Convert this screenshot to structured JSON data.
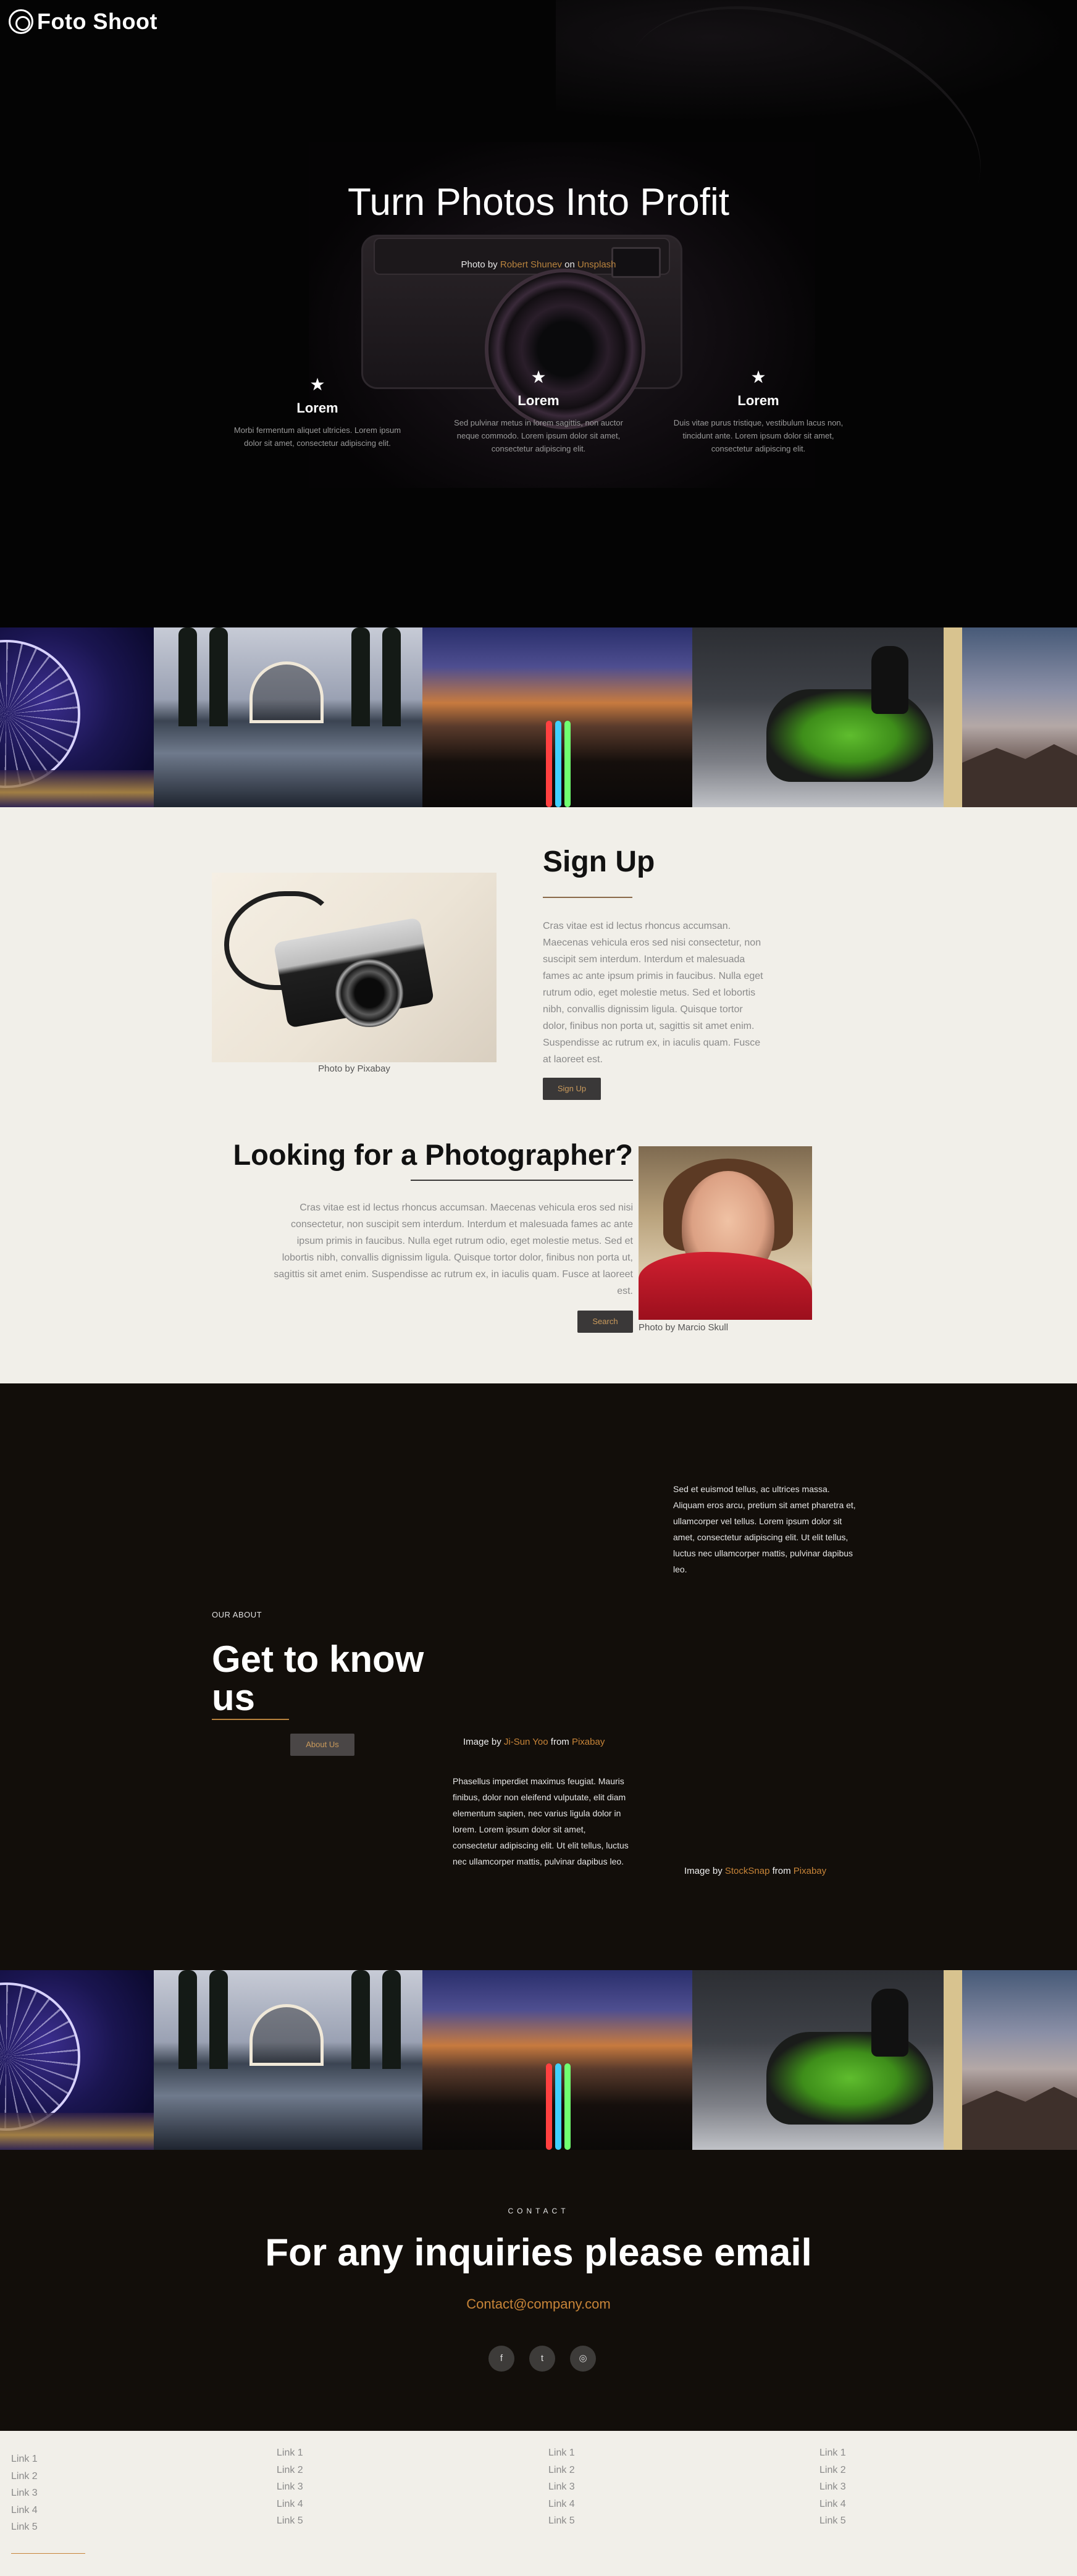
{
  "brand": {
    "name": "Foto Shoot"
  },
  "hero": {
    "title": "Turn Photos Into Profit",
    "credit_prefix": "Photo by",
    "credit_author": "Robert Shunev",
    "credit_mid": "on",
    "credit_source": "Unsplash",
    "features": [
      {
        "title": "Lorem",
        "text": "Morbi fermentum aliquet ultricies. Lorem ipsum dolor sit amet, consectetur adipiscing elit."
      },
      {
        "title": "Lorem",
        "text": "Sed pulvinar metus in lorem sagittis, non auctor neque commodo. Lorem ipsum dolor sit amet, consectetur adipiscing elit."
      },
      {
        "title": "Lorem",
        "text": "Duis vitae purus tristique, vestibulum lacus non, tincidunt ante. Lorem ipsum dolor sit amet, consectetur adipiscing elit."
      }
    ]
  },
  "signup": {
    "title": "Sign Up",
    "body": "Cras vitae est id lectus rhoncus accumsan. Maecenas vehicula eros sed nisi consectetur, non suscipit sem interdum. Interdum et malesuada fames ac ante ipsum primis in faucibus. Nulla eget rutrum odio, eget molestie metus. Sed et lobortis nibh, convallis dignissim ligula. Quisque tortor dolor, finibus non porta ut, sagittis sit amet enim. Suspendisse ac rutrum ex, in iaculis quam. Fusce at laoreet est.",
    "button": "Sign Up",
    "image_credit": "Photo by Pixabay"
  },
  "photographer": {
    "title": "Looking for a Photographer?",
    "body": "Cras vitae est id lectus rhoncus accumsan. Maecenas vehicula eros sed nisi consectetur, non suscipit sem interdum. Interdum et malesuada fames ac ante ipsum primis in faucibus. Nulla eget rutrum odio, eget molestie metus. Sed et lobortis nibh, convallis dignissim ligula. Quisque tortor dolor, finibus non porta ut, sagittis sit amet enim. Suspendisse ac rutrum ex, in iaculis quam. Fusce at laoreet est.",
    "button": "Search",
    "image_credit": "Photo by Marcio Skull"
  },
  "about": {
    "label": "OUR ABOUT",
    "title": "Get to know us",
    "button": "About Us",
    "para1": "Sed et euismod tellus, ac ultrices massa. Aliquam eros arcu, pretium sit amet pharetra et, ullamcorper vel tellus. Lorem ipsum dolor sit amet, consectetur adipiscing elit. Ut elit tellus, luctus nec ullamcorper mattis, pulvinar dapibus leo.",
    "para2": "Phasellus imperdiet maximus feugiat. Mauris finibus, dolor non eleifend vulputate, elit diam elementum sapien, nec varius ligula dolor in lorem. Lorem ipsum dolor sit amet, consectetur adipiscing elit. Ut elit tellus, luctus nec ullamcorper mattis, pulvinar dapibus leo.",
    "credit1": {
      "prefix": "Image by",
      "author": "Ji-Sun Yoo",
      "mid": "from",
      "source": "Pixabay"
    },
    "credit2": {
      "prefix": "Image by",
      "author": "StockSnap",
      "mid": "from",
      "source": "Pixabay"
    }
  },
  "contact": {
    "label": "CONTACT",
    "title": "For any inquiries please email",
    "email": "Contact@company.com",
    "social": [
      {
        "icon": "facebook-icon",
        "glyph": "f"
      },
      {
        "icon": "twitter-icon",
        "glyph": "t"
      },
      {
        "icon": "instagram-icon",
        "glyph": "◎"
      }
    ]
  },
  "footer": {
    "columns": [
      [
        "Link 1",
        "Link 2",
        "Link 3",
        "Link 4",
        "Link 5"
      ],
      [
        "Link 1",
        "Link 2",
        "Link 3",
        "Link 4",
        "Link 5"
      ],
      [
        "Link 1",
        "Link 2",
        "Link 3",
        "Link 4",
        "Link 5"
      ],
      [
        "Link 1",
        "Link 2",
        "Link 3",
        "Link 4",
        "Link 5"
      ]
    ]
  },
  "colors": {
    "accent": "#c78438",
    "dark": "#120e0a",
    "light": "#f1efe9"
  }
}
